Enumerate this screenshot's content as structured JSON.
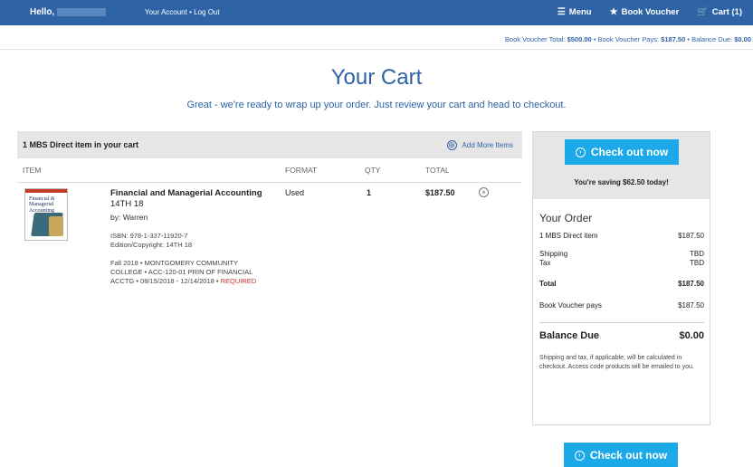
{
  "topbar": {
    "hello": "Hello,",
    "account_link": "Your Account",
    "separator": "•",
    "logout_link": "Log Out",
    "menu_label": "Menu",
    "menu_icon": "☰",
    "voucher_label": "Book Voucher",
    "voucher_icon": "★",
    "cart_label": "Cart (1)",
    "cart_icon": "🛒"
  },
  "voucher_summary": {
    "total_label": "Book Voucher Total:",
    "total_value": "$500.00",
    "pays_label": "• Book Voucher Pays:",
    "pays_value": "$187.50",
    "due_label": "• Balance Due:",
    "due_value": "$0.00"
  },
  "page": {
    "title": "Your Cart",
    "subtitle": "Great - we're ready to wrap up your order. Just review your cart and head to checkout."
  },
  "cart": {
    "count_label": "1 MBS Direct item in your cart",
    "add_more_icon": "⊕",
    "add_more_label": "Add More Items",
    "columns": {
      "item": "ITEM",
      "format": "FORMAT",
      "qty": "QTY",
      "total": "TOTAL"
    },
    "items": [
      {
        "cover_text": "Financial & Managerial Accounting",
        "title": "Financial and Managerial Accounting",
        "edition": "14TH 18",
        "by": "by: Warren",
        "isbn": "ISBN: 978-1-337-11920-7",
        "edition_copyright": "Edition/Copyright: 14TH 18",
        "term_info": "Fall 2018 • MONTGOMERY COMMUNITY COLLEGE • ACC-120-01 PRIN OF FINANCIAL ACCTG • 08/15/2018 - 12/14/2018 •",
        "required": "REQUIRED",
        "format": "Used",
        "qty": "1",
        "total": "$187.50",
        "remove_icon": "×"
      }
    ]
  },
  "sidebar": {
    "checkout_label": "Check out now",
    "checkout_icon": "›",
    "saving": "You're saving $62.50 today!",
    "order_heading": "Your Order",
    "rows": {
      "item_label": "1 MBS Direct item",
      "item_value": "$187.50",
      "shipping_label": "Shipping",
      "shipping_value": "TBD",
      "tax_label": "Tax",
      "tax_value": "TBD",
      "total_label": "Total",
      "total_value": "$187.50",
      "voucher_label": "Book Voucher pays",
      "voucher_value": "$187.50",
      "due_label": "Balance Due",
      "due_value": "$0.00"
    },
    "note": "Shipping and tax, if applicable, will be calculated in checkout. Access code products will be emailed to you."
  },
  "colors": {
    "brand_blue": "#2e63a6",
    "checkout_blue": "#1ca9e7",
    "required_red": "#d0312d"
  }
}
